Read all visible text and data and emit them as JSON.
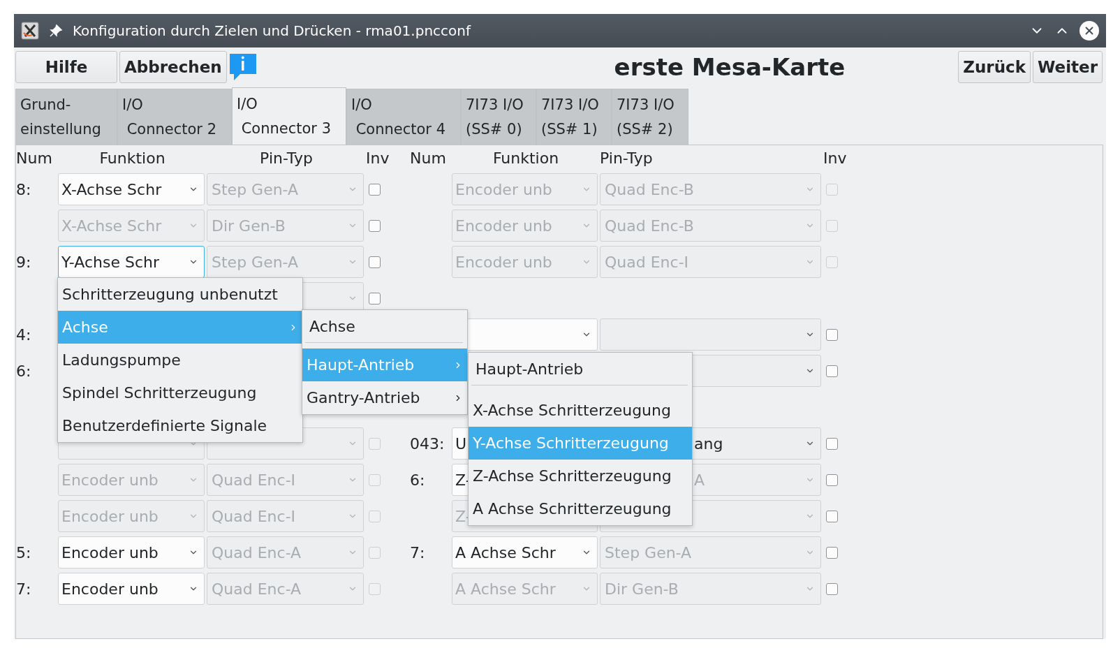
{
  "window": {
    "title": "Konfiguration durch Zielen und Drücken - rma01.pncconf"
  },
  "toolbar": {
    "left_buttons": [
      "Hilfe",
      "Abbrechen"
    ],
    "page_title": "erste Mesa-Karte",
    "right_buttons": [
      "Zurück",
      "Weiter"
    ]
  },
  "tabs": [
    {
      "label": "Grund-\neinstellung",
      "selected": false
    },
    {
      "label": "I/O\n Connector 2",
      "selected": false
    },
    {
      "label": "I/O\n Connector 3",
      "selected": true
    },
    {
      "label": "I/O\n Connector 4",
      "selected": false
    },
    {
      "label": "7I73 I/O\n(SS# 0)",
      "selected": false
    },
    {
      "label": "7I73 I/O\n(SS# 1)",
      "selected": false
    },
    {
      "label": "7I73 I/O\n(SS# 2)",
      "selected": false
    }
  ],
  "columns": {
    "left": [
      "Num",
      "Funktion",
      "Pin-Typ",
      "Inv"
    ],
    "right": [
      "Num",
      "Funktion",
      "Pin-Typ",
      "Inv"
    ]
  },
  "rows": [
    {
      "left": {
        "num": "8:",
        "function": {
          "value": "X-Achse Schr",
          "enabled": true
        },
        "pin_type": {
          "value": "Step Gen-A",
          "enabled": false
        },
        "inv": {
          "disabled": false,
          "checked": false
        }
      },
      "right": {
        "function": {
          "value": "Encoder unb",
          "enabled": false
        },
        "pin_type": {
          "value": "Quad Enc-B",
          "enabled": false
        },
        "inv": {
          "disabled": true,
          "checked": false
        }
      }
    },
    {
      "left": {
        "function": {
          "value": "X-Achse Schr",
          "enabled": false
        },
        "pin_type": {
          "value": "Dir Gen-B",
          "enabled": false
        },
        "inv": {
          "disabled": false,
          "checked": false
        }
      },
      "right": {
        "function": {
          "value": "Encoder unb",
          "enabled": false
        },
        "pin_type": {
          "value": "Quad Enc-B",
          "enabled": false
        },
        "inv": {
          "disabled": true,
          "checked": false
        }
      }
    },
    {
      "left": {
        "num": "9:",
        "function": {
          "value": "Y-Achse Schr",
          "enabled": true,
          "focused": true
        },
        "pin_type": {
          "value": "Step Gen-A",
          "enabled": false
        },
        "inv": {
          "disabled": false,
          "checked": false
        }
      },
      "right": {
        "function": {
          "value": "Encoder unb",
          "enabled": false
        },
        "pin_type": {
          "value": "Quad Enc-I",
          "enabled": false
        },
        "inv": {
          "disabled": true,
          "checked": false
        }
      }
    },
    {
      "left": {
        "pin_type": {
          "enabled": false
        },
        "inv": {
          "disabled": false,
          "checked": false
        }
      },
      "right": {}
    },
    {
      "left": {
        "num": "4:"
      },
      "right": {
        "function": {
          "enabled": true
        },
        "pin_type": {
          "enabled": true
        },
        "inv": {
          "disabled": false,
          "checked": false
        }
      }
    },
    {
      "left": {
        "num": "6:"
      },
      "right": {
        "pin_type": {
          "enabled": true
        },
        "inv": {
          "disabled": false,
          "checked": false
        }
      }
    },
    {
      "left": {},
      "right": {}
    },
    {
      "left": {
        "function": {
          "enabled": false
        },
        "pin_type": {
          "enabled": false
        },
        "inv": {
          "disabled": true,
          "checked": false
        }
      },
      "right": {
        "num": "043:",
        "function": {
          "value": "U",
          "enabled": true
        },
        "pin_type": {
          "value": "ang",
          "enabled": true
        },
        "inv": {
          "disabled": false,
          "checked": false
        }
      }
    },
    {
      "left": {
        "function": {
          "value": "Encoder unb",
          "enabled": false
        },
        "pin_type": {
          "value": "Quad Enc-I",
          "enabled": false
        },
        "inv": {
          "disabled": true,
          "checked": false
        }
      },
      "right": {
        "num": "6:",
        "function": {
          "value": "Z-",
          "enabled": true
        },
        "pin_type": {
          "value": "A",
          "enabled": false
        },
        "inv": {
          "disabled": false,
          "checked": false
        }
      }
    },
    {
      "left": {
        "function": {
          "value": "Encoder unb",
          "enabled": false
        },
        "pin_type": {
          "value": "Quad Enc-I",
          "enabled": false
        },
        "inv": {
          "disabled": true,
          "checked": false
        }
      },
      "right": {
        "function": {
          "value": "Z-",
          "enabled": false
        },
        "pin_type": {
          "enabled": false
        },
        "inv": {
          "disabled": false,
          "checked": false
        }
      }
    },
    {
      "left": {
        "num": "5:",
        "function": {
          "value": "Encoder unb",
          "enabled": true
        },
        "pin_type": {
          "value": "Quad Enc-A",
          "enabled": false
        },
        "inv": {
          "disabled": true,
          "checked": false
        }
      },
      "right": {
        "num": "7:",
        "function": {
          "value": "A Achse Schr",
          "enabled": true
        },
        "pin_type": {
          "value": "Step Gen-A",
          "enabled": false
        },
        "inv": {
          "disabled": false,
          "checked": false
        }
      }
    },
    {
      "left": {
        "num": "7:",
        "function": {
          "value": "Encoder unb",
          "enabled": true
        },
        "pin_type": {
          "value": "Quad Enc-A",
          "enabled": false
        },
        "inv": {
          "disabled": true,
          "checked": false
        }
      },
      "right": {
        "function": {
          "value": "A Achse Schr",
          "enabled": false
        },
        "pin_type": {
          "value": "Dir Gen-B",
          "enabled": false
        },
        "inv": {
          "disabled": false,
          "checked": false
        }
      }
    }
  ],
  "popup_menus": [
    {
      "items": [
        {
          "label": "Schritterzeugung unbenutzt",
          "selected": false,
          "has_submenu": false
        },
        {
          "label": "Achse",
          "selected": true,
          "has_submenu": true
        },
        {
          "label": "Ladungspumpe",
          "selected": false,
          "has_submenu": false
        },
        {
          "label": "Spindel Schritterzeugung",
          "selected": false,
          "has_submenu": false
        },
        {
          "label": "Benutzerdefinierte Signale",
          "selected": false,
          "has_submenu": false
        }
      ]
    },
    {
      "title": "Achse",
      "items": [
        {
          "label": "Haupt-Antrieb",
          "selected": true,
          "has_submenu": true
        },
        {
          "label": "Gantry-Antrieb",
          "selected": false,
          "has_submenu": true
        }
      ]
    },
    {
      "title": "Haupt-Antrieb",
      "items": [
        {
          "label": "X-Achse Schritterzeugung",
          "selected": false,
          "has_submenu": false
        },
        {
          "label": "Y-Achse Schritterzeugung",
          "selected": true,
          "has_submenu": false
        },
        {
          "label": "Z-Achse Schritterzeugung",
          "selected": false,
          "has_submenu": false
        },
        {
          "label": "A Achse Schritterzeugung",
          "selected": false,
          "has_submenu": false
        }
      ]
    }
  ]
}
